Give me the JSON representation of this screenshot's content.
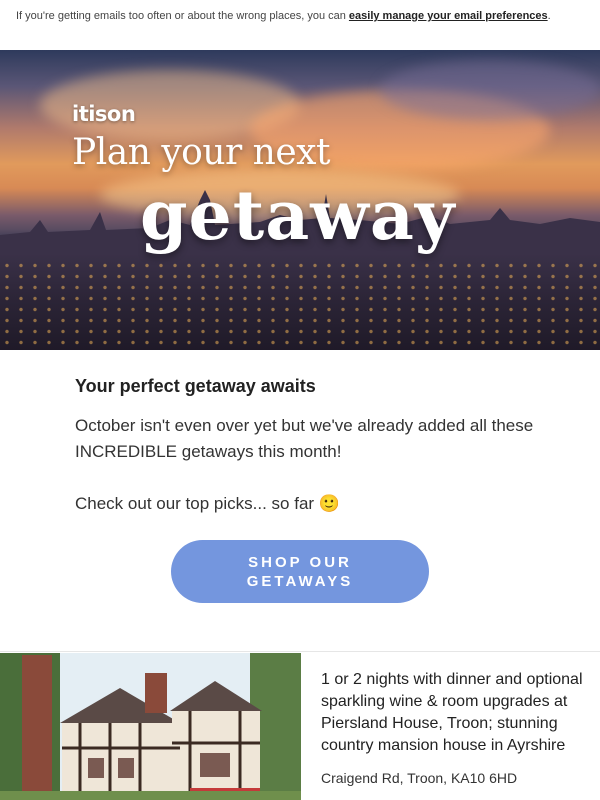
{
  "preferences": {
    "text": "If you're getting emails too often or about the wrong places, you can ",
    "link_label": "easily manage your email preferences",
    "suffix": "."
  },
  "hero": {
    "brand": "itison",
    "line1": "Plan your next",
    "line2": "getaway"
  },
  "intro": {
    "heading": "Your perfect getaway awaits",
    "paragraph1": "October isn't even over yet but we've already added all these INCREDIBLE getaways this month!",
    "paragraph2": "Check out our top picks... so far 🙂"
  },
  "cta": {
    "line1": "SHOP OUR",
    "line2": "GETAWAYS"
  },
  "deal": {
    "title": "1 or 2 nights with dinner and optional sparkling wine & room upgrades at Piersland House, Troon; stunning country mansion house in Ayrshire",
    "address": "Craigend Rd, Troon, KA10 6HD"
  },
  "colors": {
    "cta": "#7496de",
    "text": "#222222"
  }
}
